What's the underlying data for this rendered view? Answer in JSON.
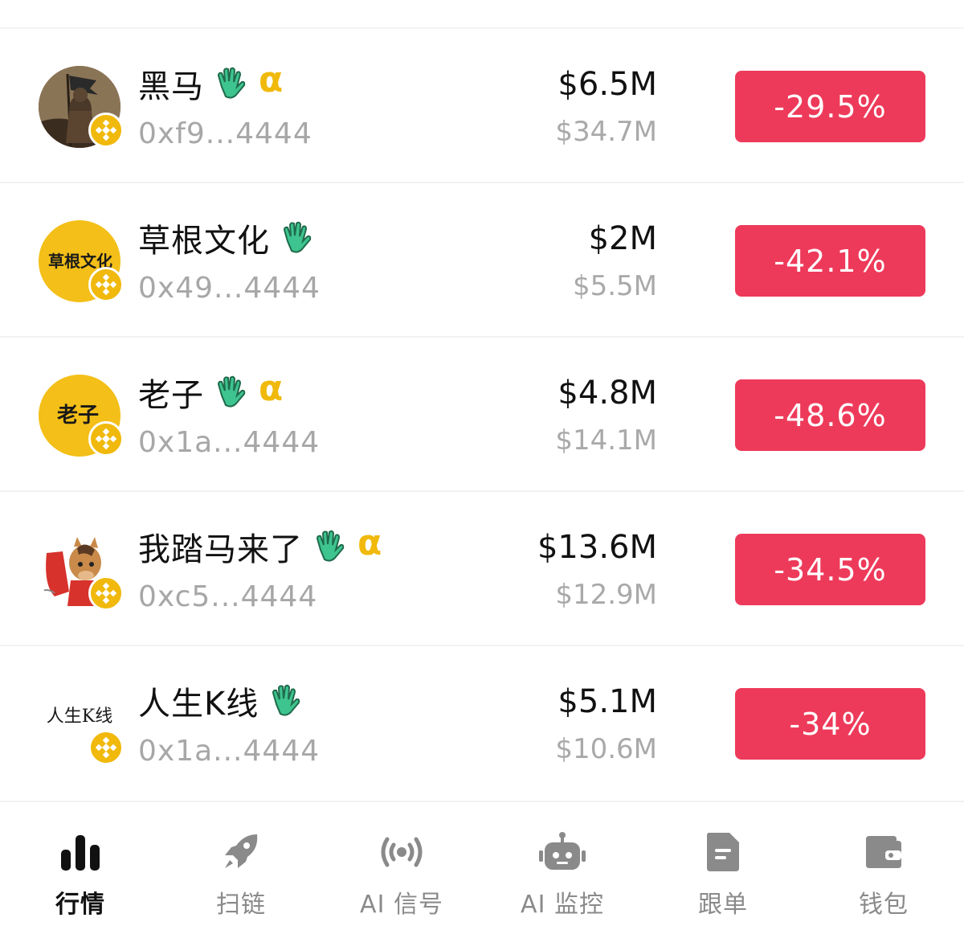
{
  "colors": {
    "negative": "#ee3a5a",
    "chain_badge": "#f0b90b",
    "hand_icon": "#3ec48e",
    "alpha": "#f0b90b",
    "muted_text": "#a7a7a7",
    "nav_inactive": "#8a8a8a",
    "nav_active": "#111111"
  },
  "tokens": [
    {
      "name": "黑马",
      "address": "0xf9...4444",
      "market_cap": "$6.5M",
      "volume": "$34.7M",
      "change": "-29.5%",
      "avatar_text": "",
      "avatar_style": "image",
      "icons": [
        "hand-wave-icon",
        "alpha-icon"
      ]
    },
    {
      "name": "草根文化",
      "address": "0x49...4444",
      "market_cap": "$2M",
      "volume": "$5.5M",
      "change": "-42.1%",
      "avatar_text": "草根文化",
      "avatar_style": "yellow",
      "icons": [
        "hand-wave-icon"
      ]
    },
    {
      "name": "老子",
      "address": "0x1a...4444",
      "market_cap": "$4.8M",
      "volume": "$14.1M",
      "change": "-48.6%",
      "avatar_text": "老子",
      "avatar_style": "yellow",
      "icons": [
        "hand-wave-icon",
        "alpha-icon"
      ]
    },
    {
      "name": "我踏马来了",
      "address": "0xc5...4444",
      "market_cap": "$13.6M",
      "volume": "$12.9M",
      "change": "-34.5%",
      "avatar_text": "",
      "avatar_style": "horse",
      "icons": [
        "hand-wave-icon",
        "alpha-icon"
      ]
    },
    {
      "name": "人生K线",
      "address": "0x1a...4444",
      "market_cap": "$5.1M",
      "volume": "$10.6M",
      "change": "-34%",
      "avatar_text": "人生K线",
      "avatar_style": "white",
      "icons": [
        "hand-wave-icon"
      ]
    }
  ],
  "alpha_symbol": "α",
  "bottom_nav": {
    "active_index": 0,
    "items": [
      {
        "label": "行情",
        "icon": "bar-chart-icon"
      },
      {
        "label": "扫链",
        "icon": "rocket-icon"
      },
      {
        "label": "AI 信号",
        "icon": "broadcast-icon"
      },
      {
        "label": "AI 监控",
        "icon": "robot-icon"
      },
      {
        "label": "跟单",
        "icon": "document-icon"
      },
      {
        "label": "钱包",
        "icon": "wallet-icon"
      }
    ]
  }
}
